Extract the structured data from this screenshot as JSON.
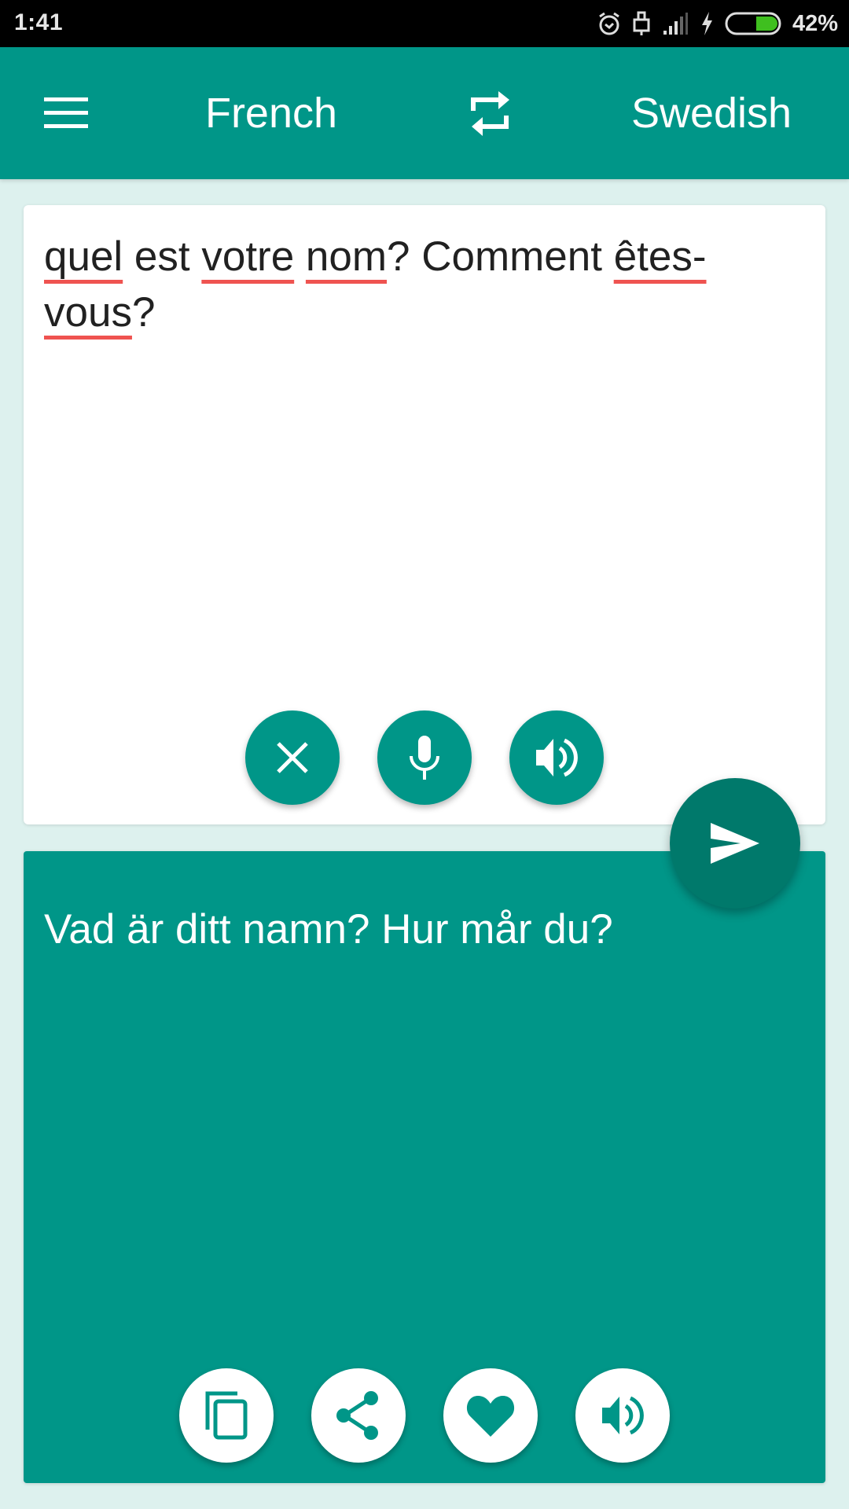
{
  "status_bar": {
    "time": "1:41",
    "battery_percent": "42%",
    "battery_level": 0.42,
    "icons": [
      "alarm-icon",
      "usb-lock-icon",
      "signal-icon",
      "charging-icon",
      "battery-icon"
    ],
    "battery_color": "#3fbf1f"
  },
  "toolbar": {
    "menu_icon": "hamburger-menu-icon",
    "source_language": "French",
    "swap_icon": "swap-languages-icon",
    "target_language": "Swedish"
  },
  "input": {
    "text_words": [
      {
        "w": "quel",
        "misspelled": true
      },
      {
        "w": " est ",
        "misspelled": false
      },
      {
        "w": "votre",
        "misspelled": true
      },
      {
        "w": " ",
        "misspelled": false
      },
      {
        "w": "nom",
        "misspelled": true
      },
      {
        "w": "? Comment ",
        "misspelled": false
      },
      {
        "w": "êtes-",
        "misspelled": true
      },
      {
        "w": "vous",
        "misspelled": true
      },
      {
        "w": "?",
        "misspelled": false
      }
    ],
    "full_text": "quel est votre nom? Comment êtes-vous?",
    "actions": [
      {
        "name": "clear",
        "icon": "close-icon"
      },
      {
        "name": "microphone",
        "icon": "microphone-icon"
      },
      {
        "name": "speak",
        "icon": "speaker-icon"
      }
    ]
  },
  "translate_button": {
    "icon": "send-icon"
  },
  "output": {
    "text": "Vad är ditt namn? Hur mår du?",
    "actions": [
      {
        "name": "copy",
        "icon": "copy-icon"
      },
      {
        "name": "share",
        "icon": "share-icon"
      },
      {
        "name": "favorite",
        "icon": "heart-icon"
      },
      {
        "name": "speak",
        "icon": "speaker-icon"
      }
    ]
  },
  "colors": {
    "primary": "#009688",
    "primary_dark": "#00796b",
    "background": "#ddf1ee",
    "spell_underline": "#ef5350"
  }
}
